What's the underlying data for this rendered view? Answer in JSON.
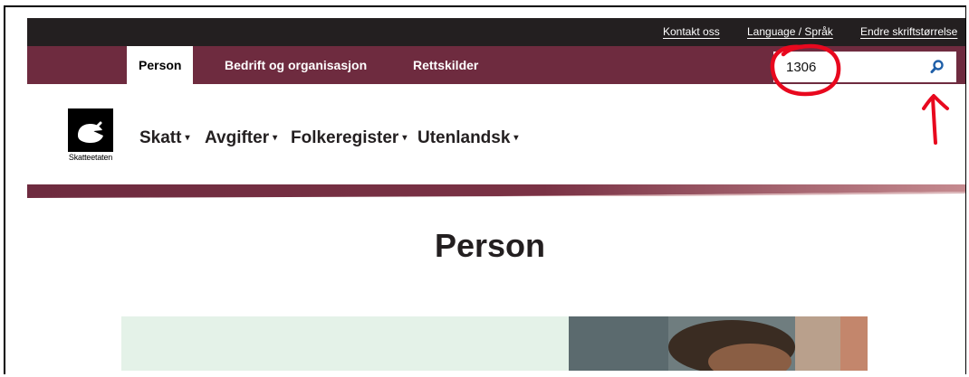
{
  "topbar": {
    "links": [
      {
        "label": "Kontakt oss"
      },
      {
        "label": "Language / Språk"
      },
      {
        "label": "Endre skriftstørrelse"
      }
    ]
  },
  "navbar": {
    "tabs": [
      {
        "label": "Person",
        "active": true
      },
      {
        "label": "Bedrift og organisasjon"
      },
      {
        "label": "Rettskilder"
      }
    ]
  },
  "search": {
    "value": "1306",
    "icon": "magnifier-icon"
  },
  "logo": {
    "text": "Skatteetaten"
  },
  "mainnav": {
    "items": [
      {
        "label": "Skatt"
      },
      {
        "label": "Avgifter"
      },
      {
        "label": "Folkeregister"
      },
      {
        "label": "Utenlandsk"
      }
    ],
    "caret": "▾"
  },
  "main": {
    "title": "Person"
  },
  "colors": {
    "topbar": "#231f20",
    "navbar": "#6e2b3f",
    "accent_blue": "#1f5fa8",
    "annotation_red": "#e8081e",
    "hero_mint": "#e4f2e8"
  }
}
